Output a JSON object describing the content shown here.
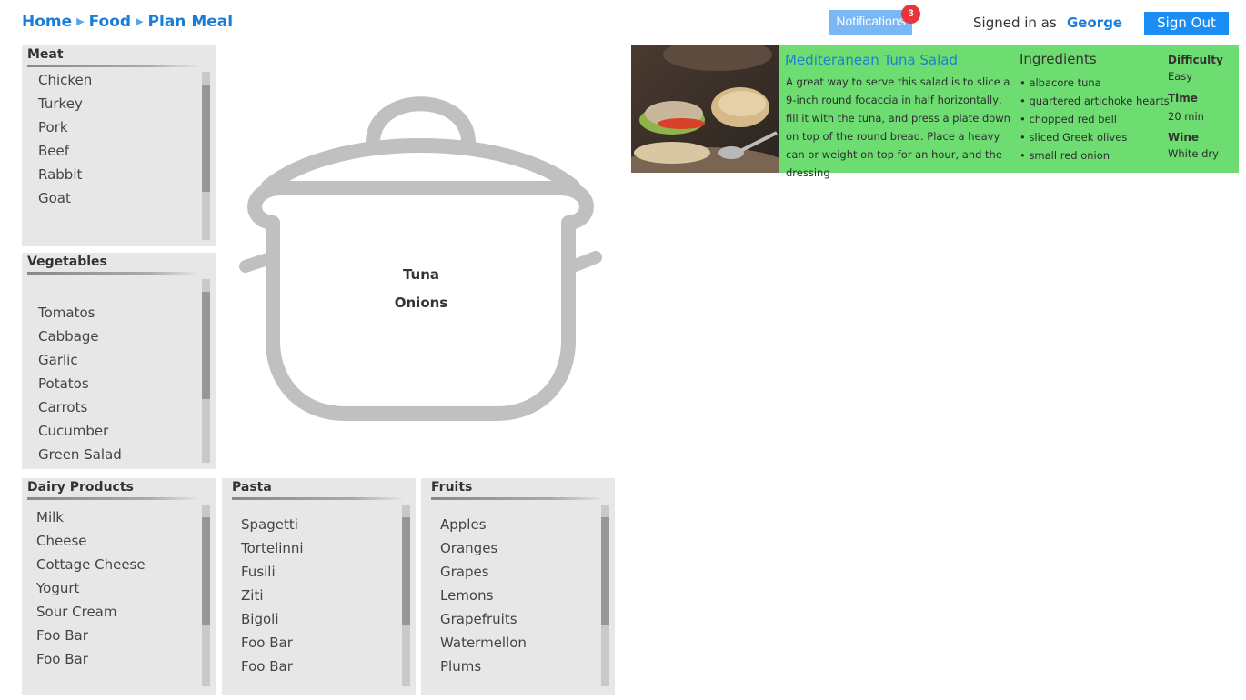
{
  "breadcrumb": {
    "home": "Home",
    "food": "Food",
    "plan_meal": "Plan Meal",
    "separator": "▶"
  },
  "header": {
    "notifications_label": "Notifications",
    "notifications_count": "3",
    "signed_in_label": "Signed in as",
    "username": "George",
    "sign_out_label": "Sign Out"
  },
  "categories": {
    "meat": {
      "title": "Meat",
      "items": [
        "Chicken",
        "Turkey",
        "Pork",
        "Beef",
        "Rabbit",
        "Goat"
      ]
    },
    "vegetables": {
      "title": "Vegetables",
      "items": [
        "Tomatos",
        "Cabbage",
        "Garlic",
        "Potatos",
        "Carrots",
        "Cucumber",
        "Green Salad"
      ]
    },
    "dairy": {
      "title": "Dairy Products",
      "items": [
        "Milk",
        "Cheese",
        "Cottage Cheese",
        "Yogurt",
        "Sour Cream",
        "Foo Bar",
        "Foo Bar"
      ]
    },
    "pasta": {
      "title": "Pasta",
      "items": [
        "Spagetti",
        "Tortelinni",
        "Fusili",
        "Ziti",
        "Bigoli",
        "Foo Bar",
        "Foo Bar"
      ]
    },
    "fruits": {
      "title": "Fruits",
      "items": [
        "Apples",
        "Oranges",
        "Grapes",
        "Lemons",
        "Grapefruits",
        "Watermellon",
        "Plums"
      ]
    }
  },
  "pot": {
    "items": [
      "Tuna",
      "Onions"
    ]
  },
  "recipe": {
    "title": "Mediteranean Tuna Salad",
    "description": "A great way to serve this salad is to slice a 9-inch round focaccia in half horizontally, fill it with the tuna, and press a plate down on top of the round bread. Place a heavy can or weight on top for an hour, and the dressing",
    "ingredients_title": "Ingredients",
    "ingredients": [
      "• albacore tuna",
      "• quartered artichoke hearts",
      "• chopped red bell",
      "• sliced Greek olives",
      "• small red onion"
    ],
    "difficulty_label": "Difficulty",
    "difficulty": "Easy",
    "time_label": "Time",
    "time": "20 min",
    "wine_label": "Wine",
    "wine": "White dry"
  },
  "colors": {
    "accent_blue": "#1a7ed9",
    "button_blue": "#1a8ef2",
    "notification_bg": "#7ab8f5",
    "badge_red": "#e8343a",
    "recipe_bg": "#6ddd72",
    "panel_bg": "#e7e7e7",
    "pot_gray": "#c0c0c0"
  }
}
